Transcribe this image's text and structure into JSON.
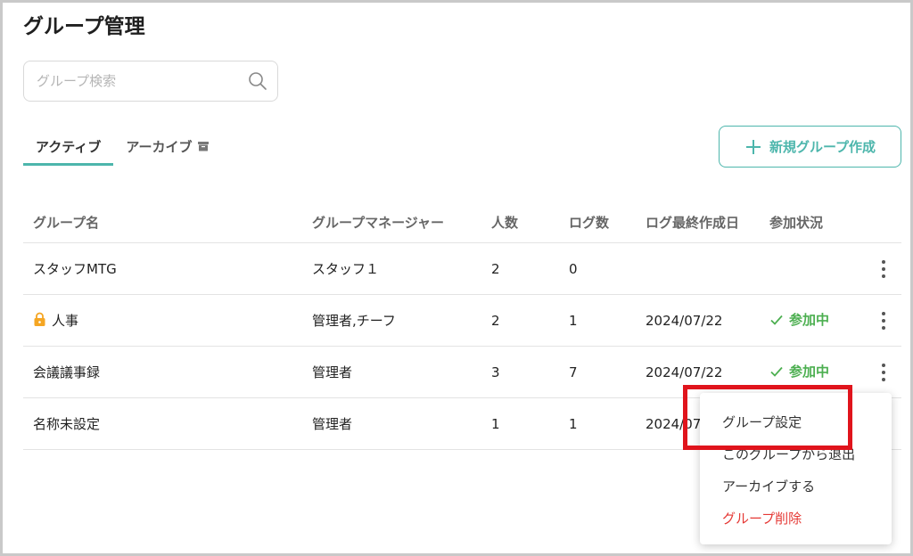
{
  "page": {
    "title": "グループ管理"
  },
  "search": {
    "placeholder": "グループ検索"
  },
  "tabs": [
    {
      "label": "アクティブ",
      "active": true
    },
    {
      "label": "アーカイブ",
      "icon": "archive-icon"
    }
  ],
  "new_group_button": {
    "label": "新規グループ作成",
    "icon": "plus-icon"
  },
  "table": {
    "headers": [
      "グループ名",
      "グループマネージャー",
      "人数",
      "ログ数",
      "ログ最終作成日",
      "参加状況"
    ],
    "rows": [
      {
        "name": "スタッフMTG",
        "manager": "スタッフ１",
        "members": "2",
        "logs": "0",
        "last_log": "",
        "status": ""
      },
      {
        "name": "人事",
        "locked": true,
        "manager": "管理者,チーフ",
        "members": "2",
        "logs": "1",
        "last_log": "2024/07/22",
        "status": "参加中"
      },
      {
        "name": "会議議事録",
        "manager": "管理者",
        "members": "3",
        "logs": "7",
        "last_log": "2024/07/22",
        "status": "参加中"
      },
      {
        "name": "名称未設定",
        "manager": "管理者",
        "members": "1",
        "logs": "1",
        "last_log": "2024/07",
        "status": ""
      }
    ]
  },
  "context_menu": {
    "items": [
      {
        "label": "グループ設定",
        "highlighted": true
      },
      {
        "label": "このグループから退出"
      },
      {
        "label": "アーカイブする"
      },
      {
        "label": "グループ削除",
        "danger": true
      }
    ]
  },
  "colors": {
    "accent": "#4db6ac",
    "status_green": "#4caf50",
    "danger": "#e53935",
    "highlight_box": "#e0141c",
    "lock": "#f5a623"
  }
}
